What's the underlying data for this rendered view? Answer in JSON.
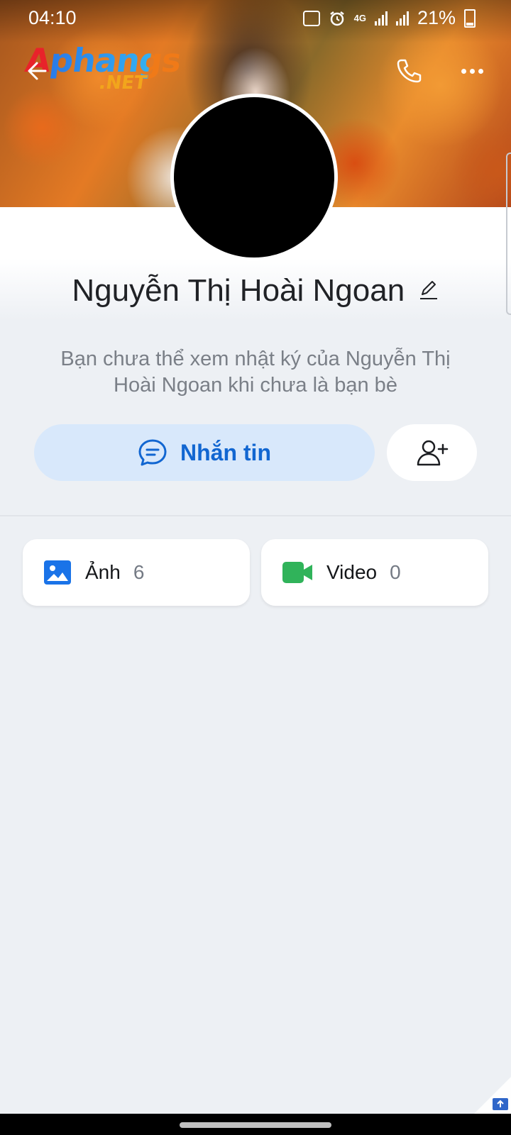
{
  "status_bar": {
    "time": "04:10",
    "network": "4G",
    "battery": "21%"
  },
  "watermark": {
    "line1": "Aphangs",
    "line2": ".NET"
  },
  "profile": {
    "name": "Nguyễn Thị Hoài Ngoan",
    "notice": "Bạn chưa thể xem nhật ký của Nguyễn Thị Hoài Ngoan khi chưa là bạn bè"
  },
  "actions": {
    "message_label": "Nhắn tin"
  },
  "media": {
    "photos_label": "Ảnh",
    "photos_count": "6",
    "videos_label": "Video",
    "videos_count": "0"
  },
  "colors": {
    "accent": "#1166d1",
    "message_bg": "#d8e8fb",
    "video_green": "#30b35a",
    "page_bg": "#edf0f4"
  },
  "icons": [
    "back-arrow-icon",
    "phone-icon",
    "more-icon",
    "edit-icon",
    "chat-icon",
    "add-friend-icon",
    "photo-icon",
    "video-icon"
  ]
}
